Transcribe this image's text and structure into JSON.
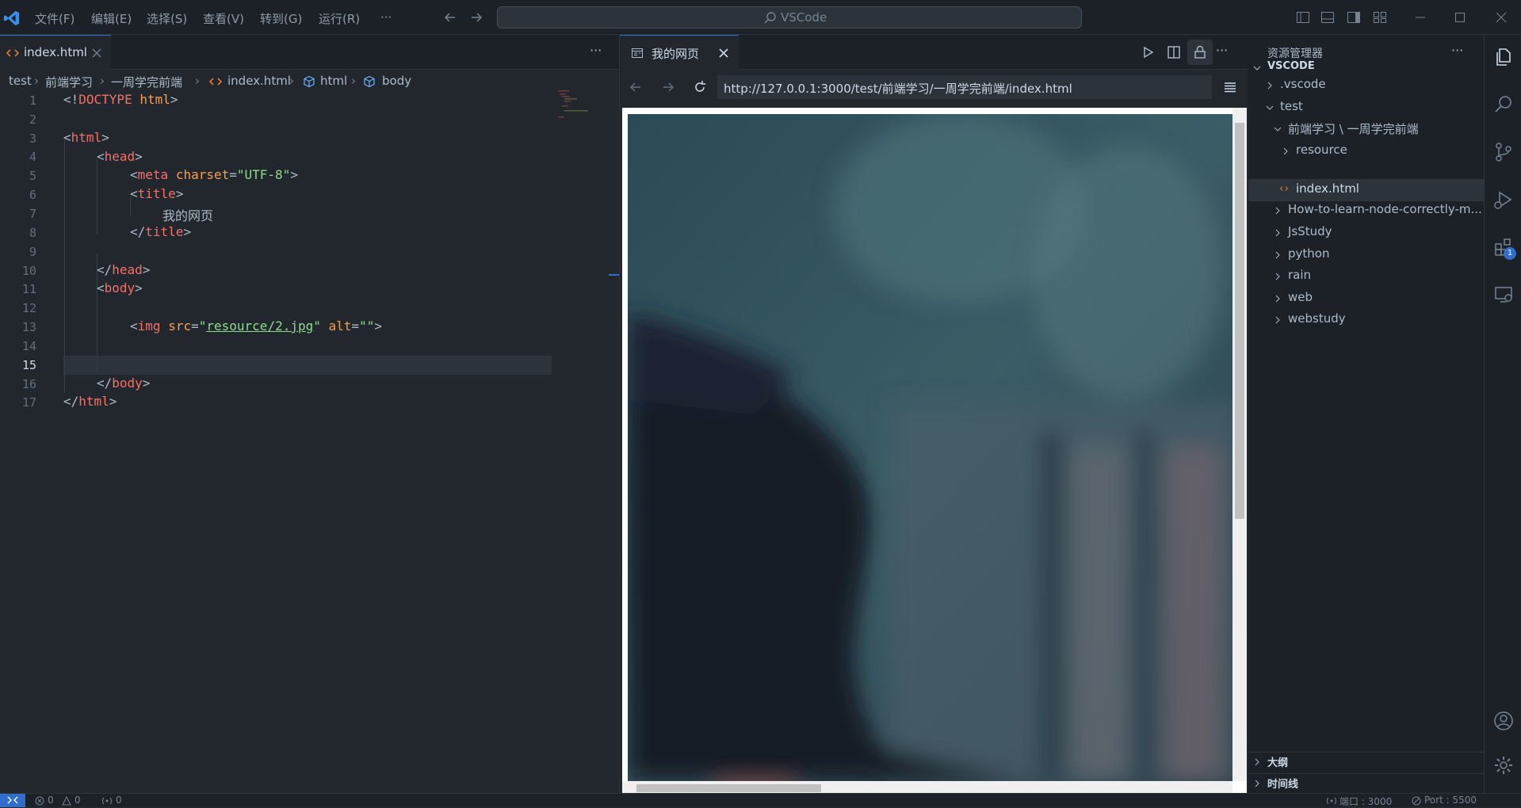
{
  "titlebar": {
    "menu": [
      "文件(F)",
      "编辑(E)",
      "选择(S)",
      "查看(V)",
      "转到(G)",
      "运行(R)",
      "···"
    ],
    "search_text": "VSCode"
  },
  "editor": {
    "tab_label": "index.html",
    "more_label": "···",
    "breadcrumb": [
      "test",
      "前端学习",
      "一周学完前端",
      "index.html",
      "html",
      "body"
    ],
    "current_line": 15,
    "lines": [
      {
        "n": "1"
      },
      {
        "n": "2"
      },
      {
        "n": "3"
      },
      {
        "n": "4"
      },
      {
        "n": "5"
      },
      {
        "n": "6"
      },
      {
        "n": "7"
      },
      {
        "n": "8"
      },
      {
        "n": "9"
      },
      {
        "n": "10"
      },
      {
        "n": "11"
      },
      {
        "n": "12"
      },
      {
        "n": "13"
      },
      {
        "n": "14"
      },
      {
        "n": "15"
      },
      {
        "n": "16"
      },
      {
        "n": "17"
      }
    ],
    "code": {
      "l1a": "<!",
      "l1b": "DOCTYPE",
      "l1c": " ",
      "l1d": "html",
      "l1e": ">",
      "l3a": "<",
      "l3b": "html",
      "l3c": ">",
      "l4a": "<",
      "l4b": "head",
      "l4c": ">",
      "l5a": "<",
      "l5b": "meta",
      "l5c": " ",
      "l5d": "charset",
      "l5e": "=",
      "l5f": "\"UTF-8\"",
      "l5g": ">",
      "l6a": "<",
      "l6b": "title",
      "l6c": ">",
      "l7": "我的网页",
      "l8a": "</",
      "l8b": "title",
      "l8c": ">",
      "l10a": "</",
      "l10b": "head",
      "l10c": ">",
      "l11a": "<",
      "l11b": "body",
      "l11c": ">",
      "l13a": "<",
      "l13b": "img",
      "l13c": " ",
      "l13d": "src",
      "l13e": "=",
      "l13f": "\"",
      "l13g": "resource/2.jpg",
      "l13h": "\"",
      "l13i": " ",
      "l13j": "alt",
      "l13k": "=",
      "l13l": "\"\"",
      "l13m": ">",
      "l16a": "</",
      "l16b": "body",
      "l16c": ">",
      "l17a": "</",
      "l17b": "html",
      "l17c": ">"
    }
  },
  "preview": {
    "tab_label": "我的网页",
    "url": "http://127.0.0.1:3000/test/前端学习/一周学完前端/index.html"
  },
  "explorer": {
    "title": "资源管理器",
    "more_label": "···",
    "root": "VSCODE",
    "items": [
      {
        "label": ".vscode"
      },
      {
        "label": "test"
      },
      {
        "label": "前端学习 \\ 一周学完前端"
      },
      {
        "label": "resource"
      },
      {
        "label": "index.html"
      },
      {
        "label": "How-to-learn-node-correctly-m..."
      },
      {
        "label": "JsStudy"
      },
      {
        "label": "python"
      },
      {
        "label": "rain"
      },
      {
        "label": "web"
      },
      {
        "label": "webstudy"
      }
    ],
    "outline": "大纲",
    "timeline": "时间线"
  },
  "activity": {
    "extensions_badge": "1"
  },
  "statusbar": {
    "errors": "0",
    "warnings": "0",
    "ports": "0",
    "port_text": "端口 : 3000",
    "live_text": "Port : 5500"
  },
  "colors": {
    "accent": "#316dca",
    "background": "#22272e",
    "sidebar": "#1c2128",
    "badge": "#316dca"
  }
}
